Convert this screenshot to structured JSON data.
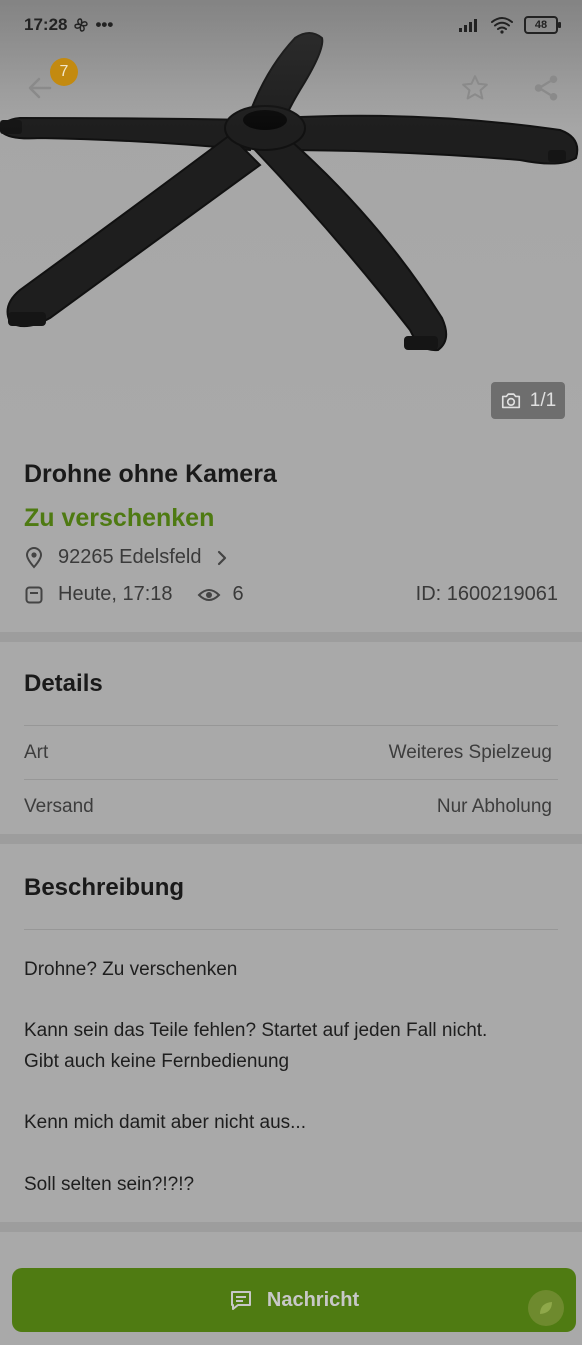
{
  "status_bar": {
    "time": "17:28",
    "dots": "•••",
    "battery": "48"
  },
  "header": {
    "notification_count": "7",
    "photo_counter": "1/1"
  },
  "ad": {
    "title": "Drohne ohne Kamera",
    "price": "Zu verschenken",
    "location": "92265 Edelsfeld",
    "date": "Heute, 17:18",
    "views": "6",
    "id": "ID: 1600219061"
  },
  "details": {
    "title": "Details",
    "rows": [
      {
        "label": "Art",
        "value": "Weiteres Spielzeug"
      },
      {
        "label": "Versand",
        "value": "Nur Abholung"
      }
    ]
  },
  "description": {
    "title": "Beschreibung",
    "lines": [
      "Drohne? Zu verschenken",
      "Kann sein das Teile fehlen? Startet auf jeden Fall nicht.",
      "Gibt auch keine Fernbedienung",
      "Kenn mich damit aber nicht aus...",
      "Soll selten sein?!?!?"
    ]
  },
  "footer": {
    "message_button": "Nachricht"
  },
  "colors": {
    "accent": "#4e7a12",
    "badge": "#c38a10",
    "overlay": "#a9a9a9"
  },
  "icons": [
    "back-arrow-icon",
    "star-icon",
    "share-icon",
    "camera-icon",
    "location-pin-icon",
    "chevron-right-icon",
    "calendar-icon",
    "eye-icon",
    "message-icon"
  ]
}
